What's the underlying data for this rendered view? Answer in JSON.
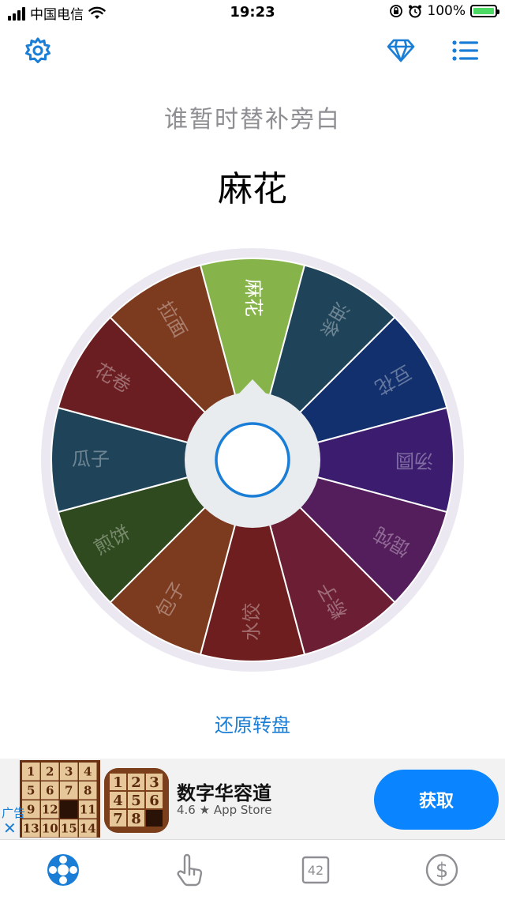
{
  "status_bar": {
    "carrier": "中国电信",
    "time": "19:23",
    "battery": "100%"
  },
  "header": {
    "settings_icon": "gear-icon",
    "premium_icon": "diamond-icon",
    "list_icon": "list-icon"
  },
  "prompt": "谁暂时替补旁白",
  "result": "麻花",
  "wheel": {
    "segments": [
      {
        "label": "麻花",
        "color": "#86b44a",
        "selected": true
      },
      {
        "label": "油条",
        "color": "#1f4358"
      },
      {
        "label": "豆花",
        "color": "#12306d"
      },
      {
        "label": "汤圆",
        "color": "#3b1c6e"
      },
      {
        "label": "馄饨",
        "color": "#541d5c"
      },
      {
        "label": "粽子",
        "color": "#6b1e34"
      },
      {
        "label": "水饺",
        "color": "#6e1e1e"
      },
      {
        "label": "包子",
        "color": "#7c3a1f"
      },
      {
        "label": "煎饼",
        "color": "#2f4a1e"
      },
      {
        "label": "瓜子",
        "color": "#1f4358"
      },
      {
        "label": "花卷",
        "color": "#6b1e22"
      },
      {
        "label": "拉面",
        "color": "#7c3a1f"
      }
    ]
  },
  "reset_label": "还原转盘",
  "ad": {
    "badge": "广告",
    "close": "✕",
    "title": "数字华容道",
    "rating": "4.6 ★ App Store",
    "get_label": "获取",
    "puzzle_tiles": [
      "1",
      "2",
      "3",
      "4",
      "5",
      "6",
      "7",
      "8",
      "9",
      "12",
      "",
      "11",
      "13",
      "10",
      "15",
      "14"
    ],
    "icon_tiles": [
      "1",
      "2",
      "3",
      "4",
      "5",
      "6",
      "7",
      "8",
      ""
    ]
  },
  "tabbar": {
    "tabs": [
      {
        "icon": "wheel-icon",
        "active": true
      },
      {
        "icon": "pointer-icon"
      },
      {
        "icon": "number-icon",
        "label": "42"
      },
      {
        "icon": "dollar-icon"
      }
    ]
  },
  "colors": {
    "accent": "#1a7ed6",
    "ad_button": "#0a84ff"
  }
}
